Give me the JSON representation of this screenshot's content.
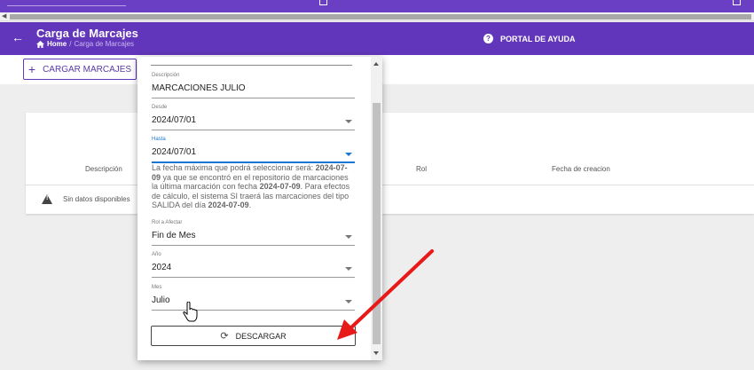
{
  "header": {
    "title": "Carga de Marcajes",
    "breadcrumb_home": "Home",
    "breadcrumb_separator": "/",
    "breadcrumb_current": "Carga de Marcajes",
    "help_label": "PORTAL DE AYUDA"
  },
  "toolbar": {
    "upload_label": "CARGAR MARCAJES"
  },
  "table": {
    "columns": [
      "Descripción",
      "Rol",
      "Fecha de creacion"
    ],
    "empty_text": "Sin datos disponibles"
  },
  "dialog": {
    "descripcion": {
      "label": "Descripción",
      "value": "MARCACIONES JULIO"
    },
    "desde": {
      "label": "Desde",
      "value": "2024/07/01"
    },
    "hasta": {
      "label": "Hasta",
      "value": "2024/07/01"
    },
    "hint": {
      "p1": "La fecha máxima que podrá seleccionar será: ",
      "b1": "2024-07-09",
      "p2": " ya que se encontró en el repositorio de marcaciones la última marcación con fecha ",
      "b2": "2024-07-09",
      "p3": ". Para efectos de cálculo, el sistema SI traerá las marcaciones del tipo SALIDA del día ",
      "b3": "2024-07-09",
      "p4": "."
    },
    "rol": {
      "label": "Rol a Afectar",
      "value": "Fin de Mes"
    },
    "anio": {
      "label": "Año",
      "value": "2024"
    },
    "mes": {
      "label": "Mes",
      "value": "Julio"
    },
    "download_label": "DESCARGAR"
  },
  "colors": {
    "header_purple": "#6236ba",
    "topbar_purple": "#6a3fc4",
    "accent_blue": "#1976d2",
    "annotation_red": "#e81919"
  },
  "icons": {
    "back": "arrow-left-icon",
    "home": "home-icon",
    "help": "help-circle-icon",
    "add": "plus-icon",
    "warning": "warning-icon",
    "refresh": "refresh-icon"
  }
}
